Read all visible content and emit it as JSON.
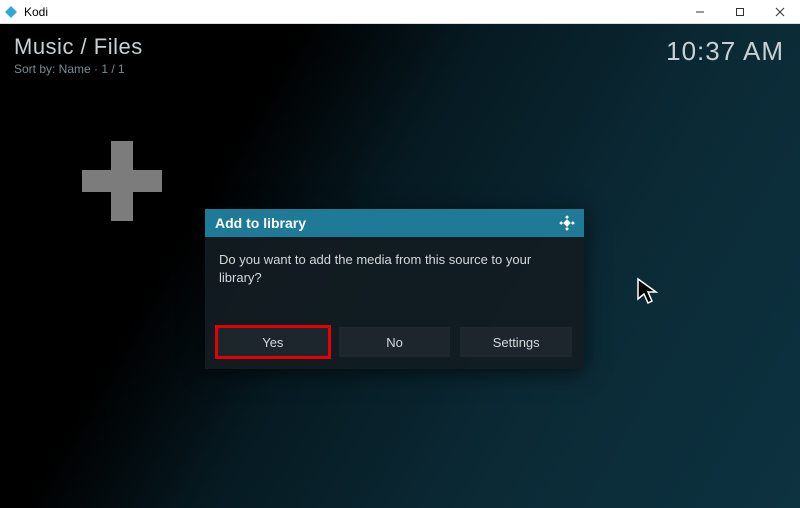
{
  "window": {
    "title": "Kodi"
  },
  "header": {
    "breadcrumb": "Music / Files",
    "sort_info": "Sort by: Name  ·  1 / 1",
    "clock": "10:37 AM"
  },
  "dialog": {
    "title": "Add to library",
    "message": "Do you want to add the media from this source to your library?",
    "buttons": {
      "yes": "Yes",
      "no": "No",
      "settings": "Settings"
    }
  }
}
